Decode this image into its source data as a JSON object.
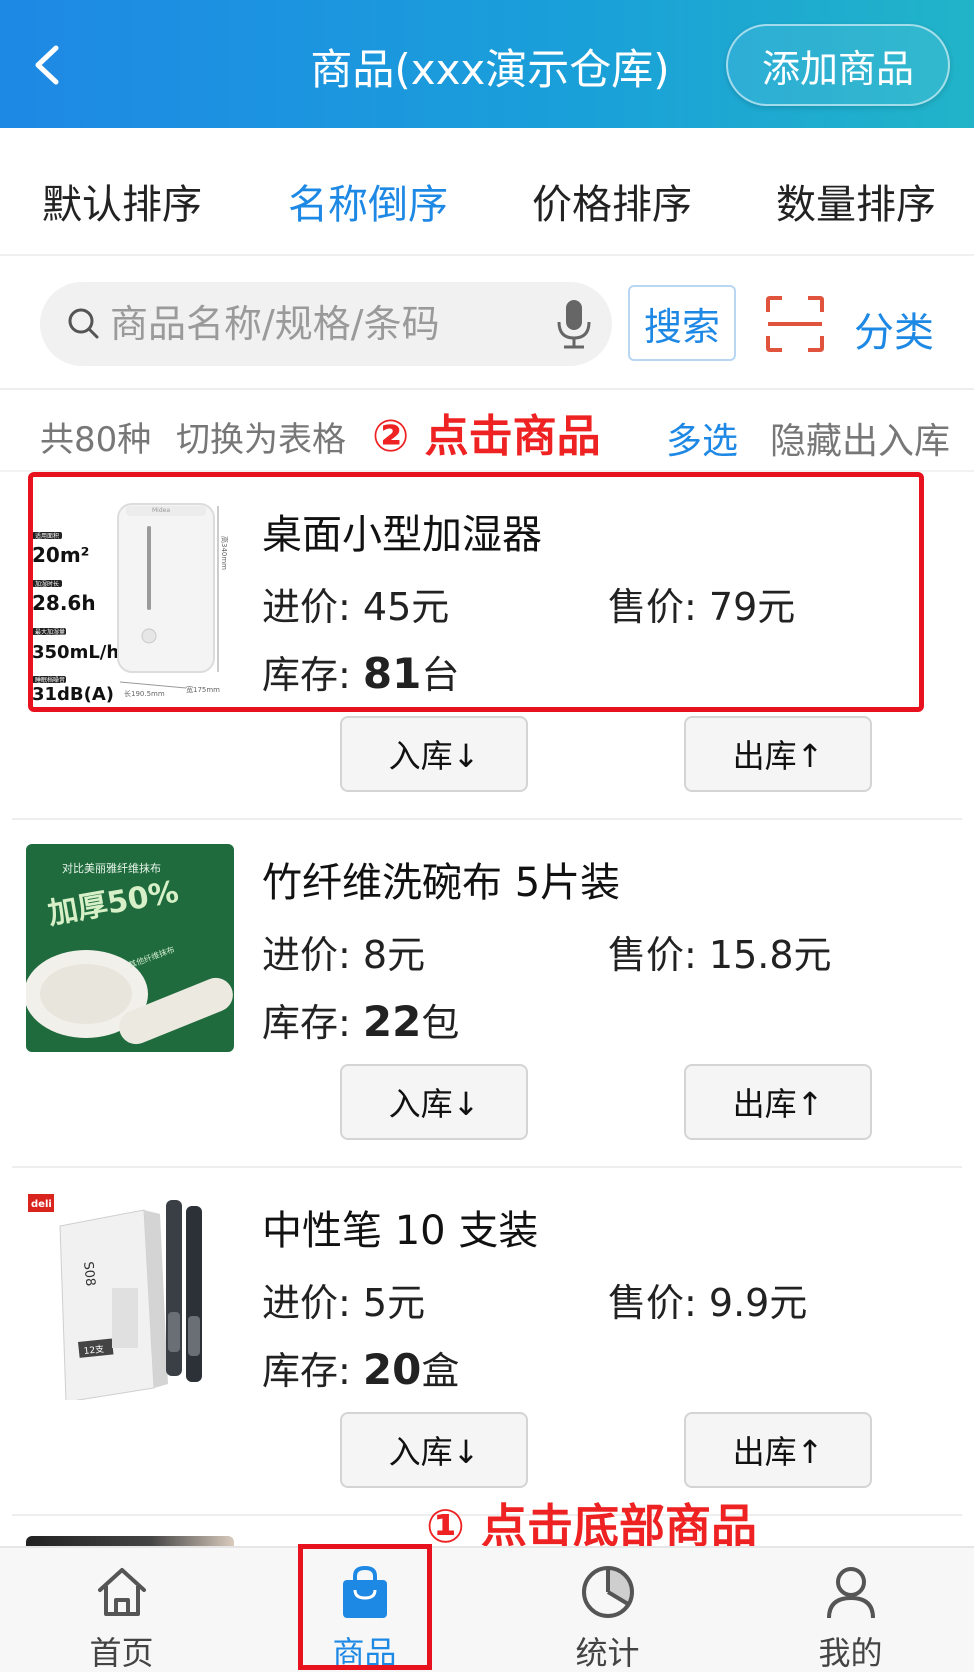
{
  "header": {
    "title": "商品(xxx演示仓库)",
    "add_label": "添加商品",
    "back_icon": "chevron-left-icon"
  },
  "sort_tabs": [
    {
      "label": "默认排序",
      "active": false
    },
    {
      "label": "名称倒序",
      "active": true
    },
    {
      "label": "价格排序",
      "active": false
    },
    {
      "label": "数量排序",
      "active": false
    }
  ],
  "search": {
    "placeholder": "商品名称/规格/条码",
    "button_label": "搜索",
    "category_label": "分类"
  },
  "info": {
    "count": "共80种",
    "switch_label": "切换为表格",
    "multi_label": "多选",
    "hide_label": "隐藏出入库"
  },
  "annotations": {
    "step2": "② 点击商品",
    "step1": "① 点击底部商品"
  },
  "labels": {
    "cost": "进价: ",
    "price": "售价: ",
    "stock": "库存: ",
    "in_button": "入库↓",
    "out_button": "出库↑"
  },
  "products": [
    {
      "name": "桌面小型加湿器",
      "cost": "45元",
      "price": "79元",
      "stock": "81",
      "unit": "台",
      "image_text": {
        "brand": "Midea",
        "spec1_label": "适用面积",
        "spec1": "20m²",
        "spec2_label": "加湿时长",
        "spec2": "28.6h",
        "spec3_label": "最大加湿量",
        "spec3": "350mL/h",
        "spec4_label": "睡眠档噪音",
        "spec4": "31dB(A)",
        "dim_height": "高340mm",
        "dim_length": "长190.5mm",
        "dim_width": "宽175mm"
      }
    },
    {
      "name": "竹纤维洗碗布  5片装",
      "cost": "8元",
      "price": "15.8元",
      "stock": "22",
      "unit": "包",
      "image_text": {
        "line1": "对比美丽雅纤维抹布",
        "line2": "加厚50%",
        "line3": "其他纤维抹布"
      }
    },
    {
      "name": "中性笔  10 支装",
      "cost": "5元",
      "price": "9.9元",
      "stock": "20",
      "unit": "盒",
      "image_text": {
        "brand": "deli",
        "model": "S08",
        "count": "12支"
      }
    }
  ],
  "nav": [
    {
      "label": "首页",
      "icon": "home-icon",
      "active": false
    },
    {
      "label": "商品",
      "icon": "shopping-bag-icon",
      "active": true
    },
    {
      "label": "统计",
      "icon": "pie-chart-icon",
      "active": false
    },
    {
      "label": "我的",
      "icon": "user-icon",
      "active": false
    }
  ],
  "colors": {
    "accent": "#1e88e5",
    "annotation": "#e8121f",
    "header_start": "#1e88e5",
    "header_end": "#21b4c8"
  }
}
